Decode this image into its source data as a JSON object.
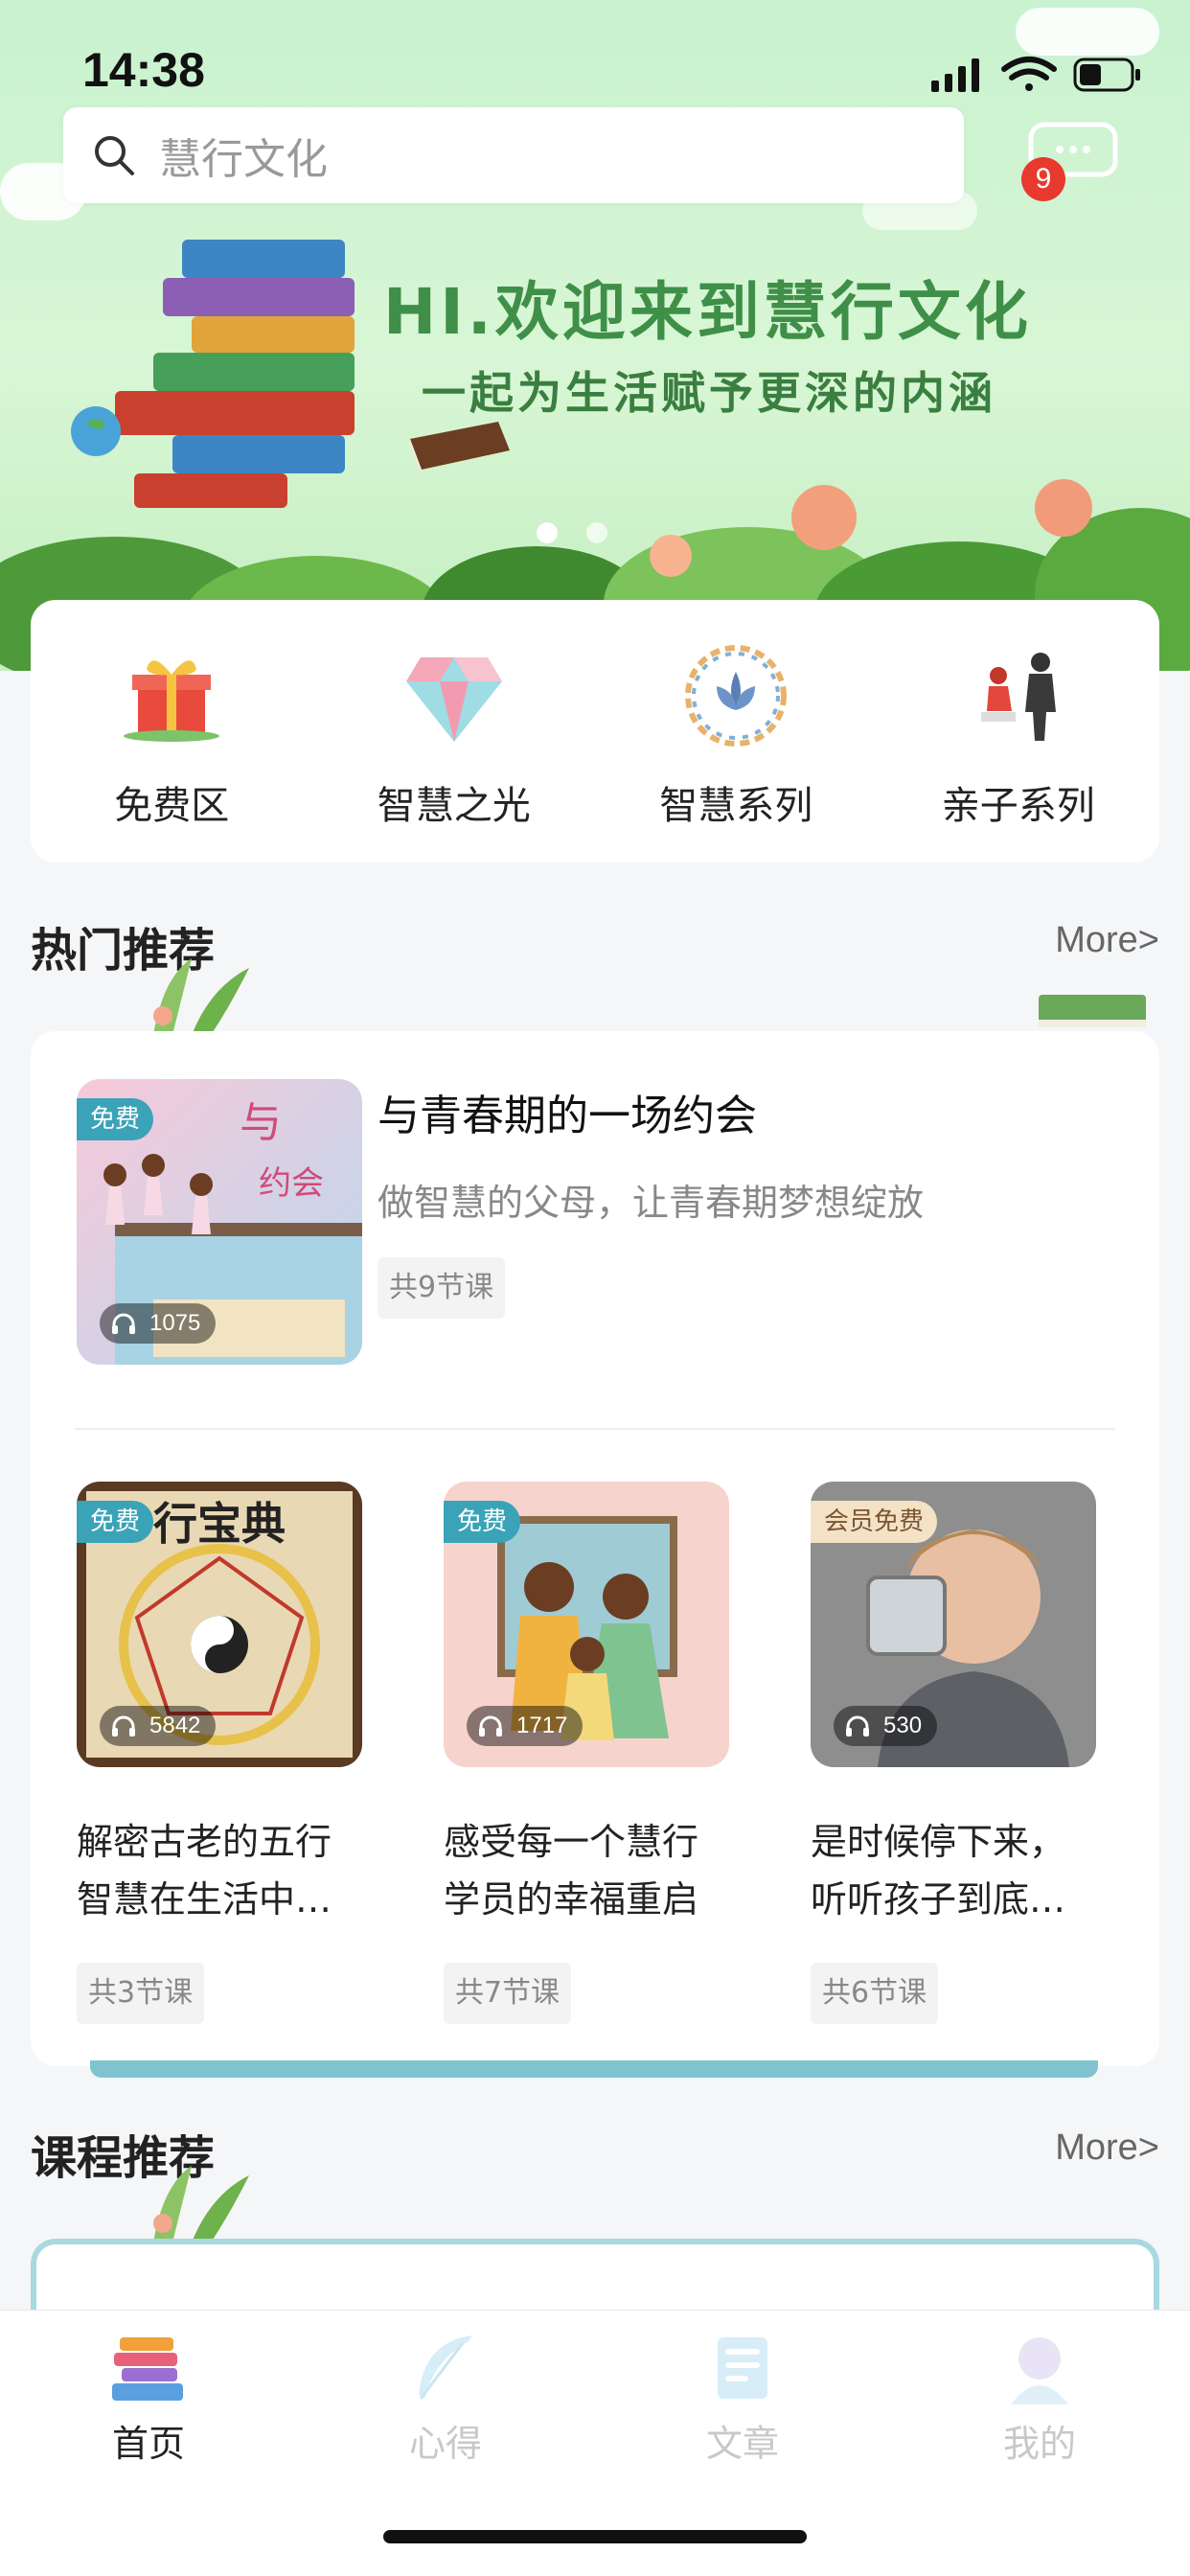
{
  "status_bar": {
    "time": "14:38"
  },
  "search": {
    "placeholder": "慧行文化"
  },
  "messages": {
    "badge_count": "9"
  },
  "banner": {
    "title": "HI.欢迎来到慧行文化",
    "subtitle": "一起为生活赋予更深的内涵",
    "slide_count": 2,
    "active_slide": 0
  },
  "categories": [
    {
      "label": "免费区",
      "icon": "gift-icon"
    },
    {
      "label": "智慧之光",
      "icon": "diamond-icon"
    },
    {
      "label": "智慧系列",
      "icon": "lily-icon"
    },
    {
      "label": "亲子系列",
      "icon": "parent-child-icon"
    }
  ],
  "hot": {
    "title": "热门推荐",
    "more": "More>",
    "featured": {
      "tag": "免费",
      "plays": "1075",
      "title": "与青春期的一场约会",
      "desc": "做智慧的父母，让青春期梦想绽放",
      "lessons": "共9节课",
      "thumb_text": "与青春期的约会"
    },
    "courses": [
      {
        "tag": "免费",
        "tag_type": "free",
        "plays": "5842",
        "title_line1": "解密古老的五行",
        "title_line2": "智慧在生活中…",
        "lessons": "共3节课",
        "thumb_text": "行宝典"
      },
      {
        "tag": "免费",
        "tag_type": "free",
        "plays": "1717",
        "title_line1": "感受每一个慧行",
        "title_line2": "学员的幸福重启",
        "lessons": "共7节课"
      },
      {
        "tag": "会员免费",
        "tag_type": "vip",
        "plays": "530",
        "title_line1": "是时候停下来，",
        "title_line2": "听听孩子到底…",
        "lessons": "共6节课"
      }
    ]
  },
  "course_section": {
    "title": "课程推荐",
    "more": "More>"
  },
  "tabbar": {
    "items": [
      {
        "label": "首页",
        "icon": "books-icon",
        "active": true
      },
      {
        "label": "心得",
        "icon": "feather-icon",
        "active": false
      },
      {
        "label": "文章",
        "icon": "article-icon",
        "active": false
      },
      {
        "label": "我的",
        "icon": "profile-icon",
        "active": false
      }
    ]
  },
  "colors": {
    "accent_tag": "#3ba3b8",
    "vip_tag": "#f4e2c6",
    "badge": "#e8392f",
    "banner_text": "#3f8f48"
  }
}
